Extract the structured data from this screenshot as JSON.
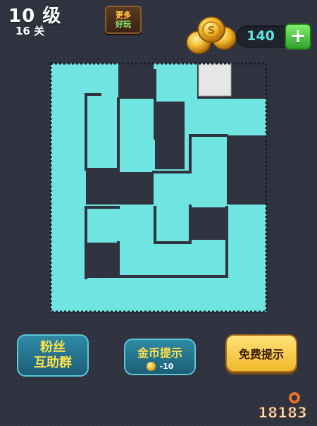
{
  "header": {
    "level_title": "10 级",
    "level_subtitle": "16 关",
    "more_games_line1": "更多",
    "more_games_line2": "好玩",
    "coin_count": "140",
    "add_label": "+"
  },
  "buttons": {
    "fans_group_line1": "粉丝",
    "fans_group_line2": "互助群",
    "coin_hint_label": "金币提示",
    "coin_hint_cost": "-10",
    "free_hint_label": "免费提示"
  },
  "watermark": {
    "text": "18183"
  },
  "colors": {
    "background": "#2e333f",
    "path": "#6fe4e0",
    "empty_cell": "#e6e6e6",
    "coin_text": "#5de6e0",
    "free_button": "#f1b92c"
  },
  "puzzle": {
    "columns": 6,
    "rows": 7,
    "empty_cells": [
      [
        4,
        0
      ]
    ],
    "blocked_cells": [
      [
        2,
        2
      ],
      [
        3,
        3
      ],
      [
        2,
        4
      ]
    ]
  }
}
